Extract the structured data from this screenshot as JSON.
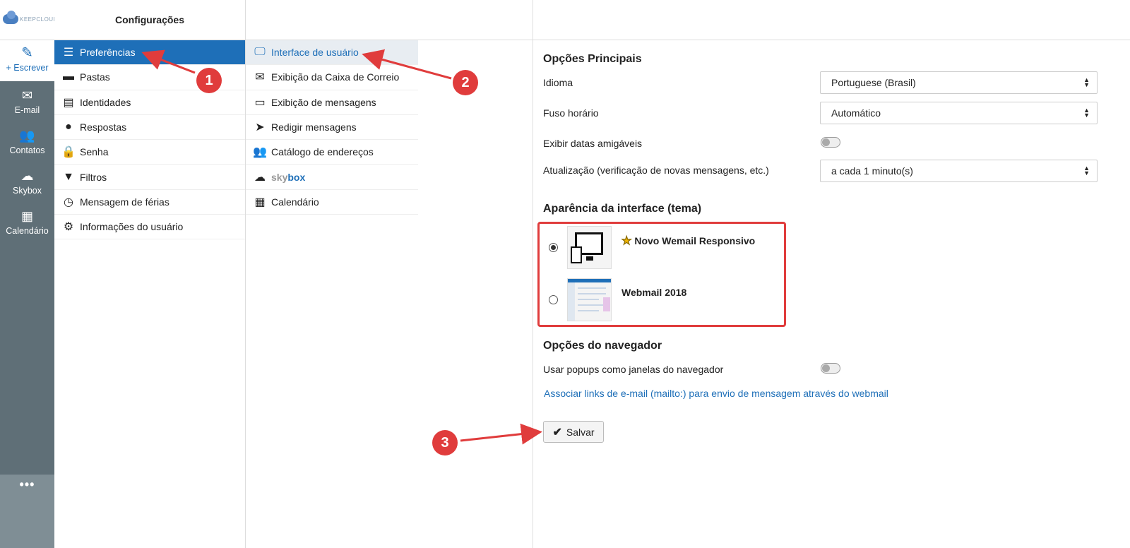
{
  "app": {
    "logo_text": "KEEPCLOUD",
    "settings_title": "Configurações"
  },
  "rail": {
    "compose_label": "+ Escrever",
    "items": [
      {
        "label": "E-mail",
        "icon": "envelope-icon"
      },
      {
        "label": "Contatos",
        "icon": "contacts-icon"
      },
      {
        "label": "Skybox",
        "icon": "skybox-icon"
      },
      {
        "label": "Calendário",
        "icon": "calendar-icon"
      }
    ],
    "more": "•••"
  },
  "settings_nav": {
    "items": [
      {
        "label": "Preferências",
        "icon": "sliders-icon",
        "active": true
      },
      {
        "label": "Pastas",
        "icon": "folder-icon"
      },
      {
        "label": "Identidades",
        "icon": "id-card-icon"
      },
      {
        "label": "Respostas",
        "icon": "comment-icon"
      },
      {
        "label": "Senha",
        "icon": "lock-icon"
      },
      {
        "label": "Filtros",
        "icon": "filter-icon"
      },
      {
        "label": "Mensagem de férias",
        "icon": "clock-icon"
      },
      {
        "label": "Informações do usuário",
        "icon": "gear-icon"
      }
    ]
  },
  "preferences_nav": {
    "items": [
      {
        "label": "Interface de usuário",
        "icon": "monitor-icon",
        "active": true
      },
      {
        "label": "Exibição da Caixa de Correio",
        "icon": "envelope-icon"
      },
      {
        "label": "Exibição de mensagens",
        "icon": "inbox-icon"
      },
      {
        "label": "Redigir mensagens",
        "icon": "paper-plane-icon"
      },
      {
        "label": "Catálogo de endereços",
        "icon": "users-icon"
      },
      {
        "label_a": "sky",
        "label_b": "box",
        "icon": "skybox-icon"
      },
      {
        "label": "Calendário",
        "icon": "calendar-icon"
      }
    ]
  },
  "main": {
    "section_main": "Opções Principais",
    "language_label": "Idioma",
    "language_value": "Portuguese (Brasil)",
    "timezone_label": "Fuso horário",
    "timezone_value": "Automático",
    "friendly_dates_label": "Exibir datas amigáveis",
    "friendly_dates_on": false,
    "refresh_label": "Atualização (verificação de novas mensagens, etc.)",
    "refresh_value": "a cada 1 minuto(s)",
    "section_theme": "Aparência da interface (tema)",
    "themes": [
      {
        "name": "Novo Wemail Responsivo",
        "selected": true
      },
      {
        "name": "Webmail 2018",
        "selected": false
      }
    ],
    "section_browser": "Opções do navegador",
    "popups_label": "Usar popups como janelas do navegador",
    "popups_on": false,
    "mailto_link": "Associar links de e-mail (mailto:) para envio de mensagem através do webmail",
    "save_label": "Salvar"
  },
  "annotations": {
    "badges": [
      "1",
      "2",
      "3"
    ],
    "color": "#e03c3c"
  },
  "colors": {
    "accent": "#1e6fb8",
    "rail": "#5f6f77"
  }
}
